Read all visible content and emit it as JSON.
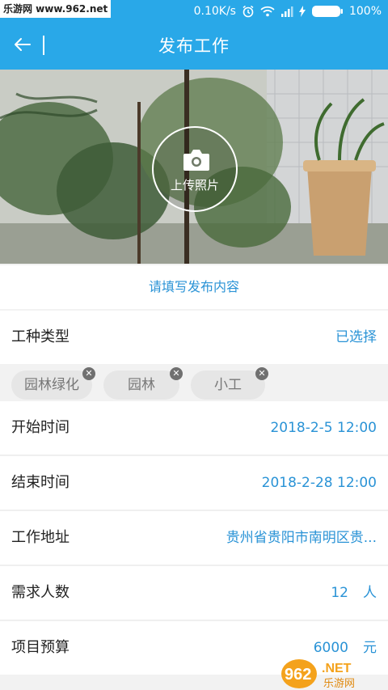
{
  "status_bar": {
    "watermark": "乐游网 www.962.net",
    "speed": "0.10K/s",
    "battery": "100%"
  },
  "app_bar": {
    "title": "发布工作",
    "back_icon": "arrow-left-icon"
  },
  "photo": {
    "upload_label": "上传照片",
    "camera_icon": "camera-icon"
  },
  "hint": "请填写发布内容",
  "work_type": {
    "label": "工种类型",
    "value": "已选择"
  },
  "chips": [
    {
      "label": "园林绿化"
    },
    {
      "label": "园林"
    },
    {
      "label": "小工"
    }
  ],
  "start_time": {
    "label": "开始时间",
    "value": "2018-2-5 12:00"
  },
  "end_time": {
    "label": "结束时间",
    "value": "2018-2-28 12:00"
  },
  "address": {
    "label": "工作地址",
    "value": "贵州省贵阳市南明区贵..."
  },
  "headcount": {
    "label": "需求人数",
    "value": "12",
    "unit": "人"
  },
  "budget": {
    "label": "项目预算",
    "value": "6000",
    "unit": "元"
  },
  "bottom_watermark": {
    "text": "962.NET",
    "sub": "乐游网"
  },
  "colors": {
    "primary": "#29a8e8",
    "accent_text": "#2a93d6"
  }
}
